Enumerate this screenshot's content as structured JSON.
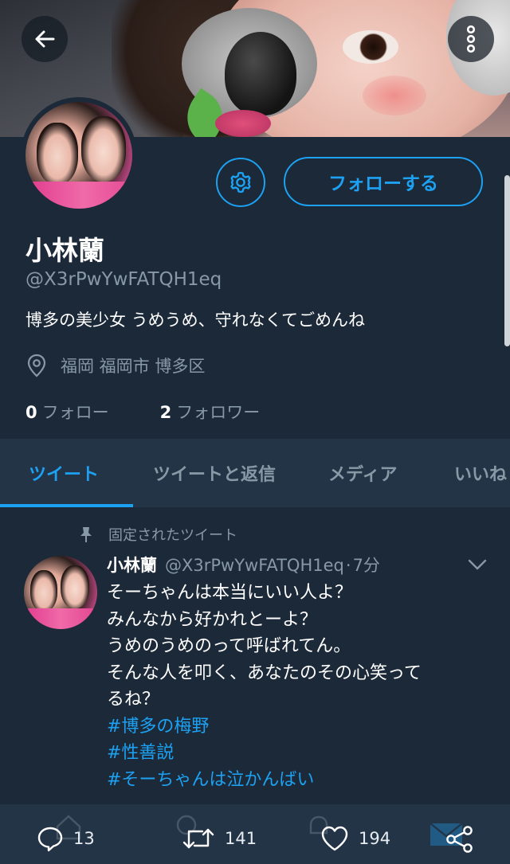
{
  "header": {
    "back_icon": "arrow-left-icon",
    "more_icon": "more-vertical-icon"
  },
  "profile": {
    "name": "小林蘭",
    "handle": "@X3rPwYwFATQH1eq",
    "bio": "博多の美少女 うめうめ、守れなくてごめんね",
    "location": "福岡 福岡市 博多区",
    "following_count": "0",
    "following_label": "フォロー",
    "followers_count": "2",
    "followers_label": "フォロワー",
    "follow_button": "フォローする"
  },
  "tabs": [
    {
      "label": "ツイート",
      "active": true
    },
    {
      "label": "ツイートと返信",
      "active": false
    },
    {
      "label": "メディア",
      "active": false
    },
    {
      "label": "いいね",
      "active": false
    }
  ],
  "tweet": {
    "pinned_label": "固定されたツイート",
    "author_name": "小林蘭",
    "author_handle": "@X3rPwYwFATQH1eq",
    "separator": "·",
    "time": "7分",
    "lines": [
      "そーちゃんは本当にいい人よ？",
      "みんなから好かれとーよ？",
      "うめのうめのって呼ばれてん。",
      "そんな人を叩く、あなたのその心笑って",
      "るね？"
    ],
    "hashtags": [
      "#博多の梅野",
      "#性善説",
      "#そーちゃんは泣かんばい"
    ],
    "reply_count": "13",
    "retweet_count": "141",
    "like_count": "194"
  },
  "colors": {
    "background": "#1c2938",
    "tab_bar": "#243447",
    "accent": "#1da1f2",
    "secondary_text": "#8899a6"
  }
}
